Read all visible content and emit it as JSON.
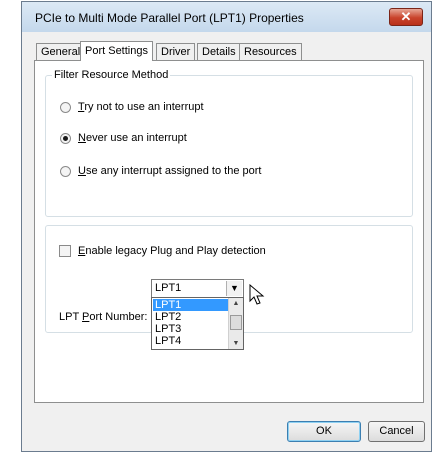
{
  "window": {
    "title": "PCIe to Multi Mode Parallel Port (LPT1) Properties",
    "close_glyph": "✕"
  },
  "tabs": [
    {
      "label": "General",
      "active": false
    },
    {
      "label": "Port Settings",
      "active": true
    },
    {
      "label": "Driver",
      "active": false
    },
    {
      "label": "Details",
      "active": false
    },
    {
      "label": "Resources",
      "active": false
    }
  ],
  "filter_group": {
    "legend": "Filter Resource Method",
    "options": [
      {
        "mnemonic": "T",
        "rest": "ry not to use an interrupt",
        "checked": false
      },
      {
        "mnemonic": "N",
        "rest": "ever use an interrupt",
        "checked": true
      },
      {
        "mnemonic": "U",
        "rest": "se any interrupt assigned to the port",
        "checked": false
      }
    ]
  },
  "legacy": {
    "mnemonic": "E",
    "rest": "nable legacy Plug and Play detection",
    "checked": false
  },
  "lpt": {
    "label_pre": "LPT ",
    "label_mnemonic": "P",
    "label_post": "ort Number:",
    "value": "LPT1",
    "arrow_glyph": "▼",
    "options": [
      "LPT1",
      "LPT2",
      "LPT3",
      "LPT4"
    ],
    "selected": "LPT1"
  },
  "scrollbar": {
    "up_glyph": "▲",
    "down_glyph": "▼"
  },
  "buttons": {
    "ok": "OK",
    "cancel": "Cancel"
  }
}
